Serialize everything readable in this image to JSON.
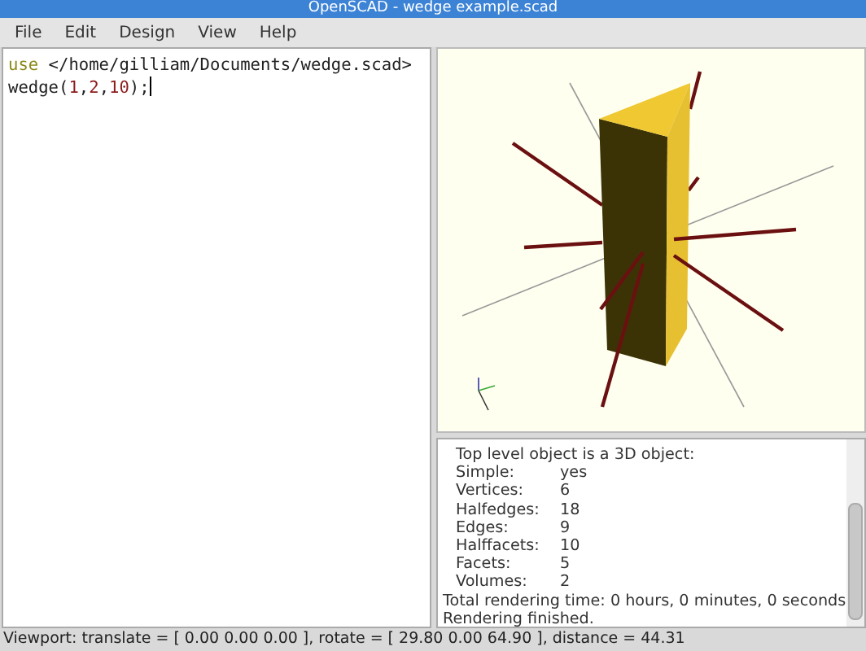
{
  "window": {
    "title": "OpenSCAD - wedge example.scad"
  },
  "menu": [
    {
      "label": "File"
    },
    {
      "label": "Edit"
    },
    {
      "label": "Design"
    },
    {
      "label": "View"
    },
    {
      "label": "Help"
    }
  ],
  "editor": {
    "lines": [
      [
        {
          "kind": "keyword",
          "text": "use"
        },
        {
          "kind": "plain",
          "text": " </home/gilliam/Documents/wedge.scad>"
        }
      ],
      [
        {
          "kind": "plain",
          "text": "wedge("
        },
        {
          "kind": "number",
          "text": "1"
        },
        {
          "kind": "plain",
          "text": ","
        },
        {
          "kind": "number",
          "text": "2"
        },
        {
          "kind": "plain",
          "text": ","
        },
        {
          "kind": "number",
          "text": "10"
        },
        {
          "kind": "plain",
          "text": ");"
        }
      ]
    ],
    "cursor": true
  },
  "console": {
    "lines": [
      {
        "kind": "indented",
        "text": "Top level object is a 3D object:"
      },
      {
        "kind": "property",
        "label": "Simple:",
        "value": "yes"
      },
      {
        "kind": "property",
        "label": "Vertices:",
        "value": "6"
      },
      {
        "kind": "property",
        "label": "Halfedges:",
        "value": "18"
      },
      {
        "kind": "property",
        "label": "Edges:",
        "value": "9"
      },
      {
        "kind": "property",
        "label": "Halffacets:",
        "value": "10"
      },
      {
        "kind": "property",
        "label": "Facets:",
        "value": "5"
      },
      {
        "kind": "property",
        "label": "Volumes:",
        "value": "2"
      },
      {
        "kind": "plain",
        "text": "Total rendering time: 0 hours, 0 minutes, 0 seconds"
      },
      {
        "kind": "plain",
        "text": "Rendering finished."
      }
    ]
  },
  "status_bar": {
    "text": "Viewport: translate = [ 0.00 0.00 0.00 ], rotate = [ 29.80 0.00 64.90 ], distance = 44.31"
  }
}
